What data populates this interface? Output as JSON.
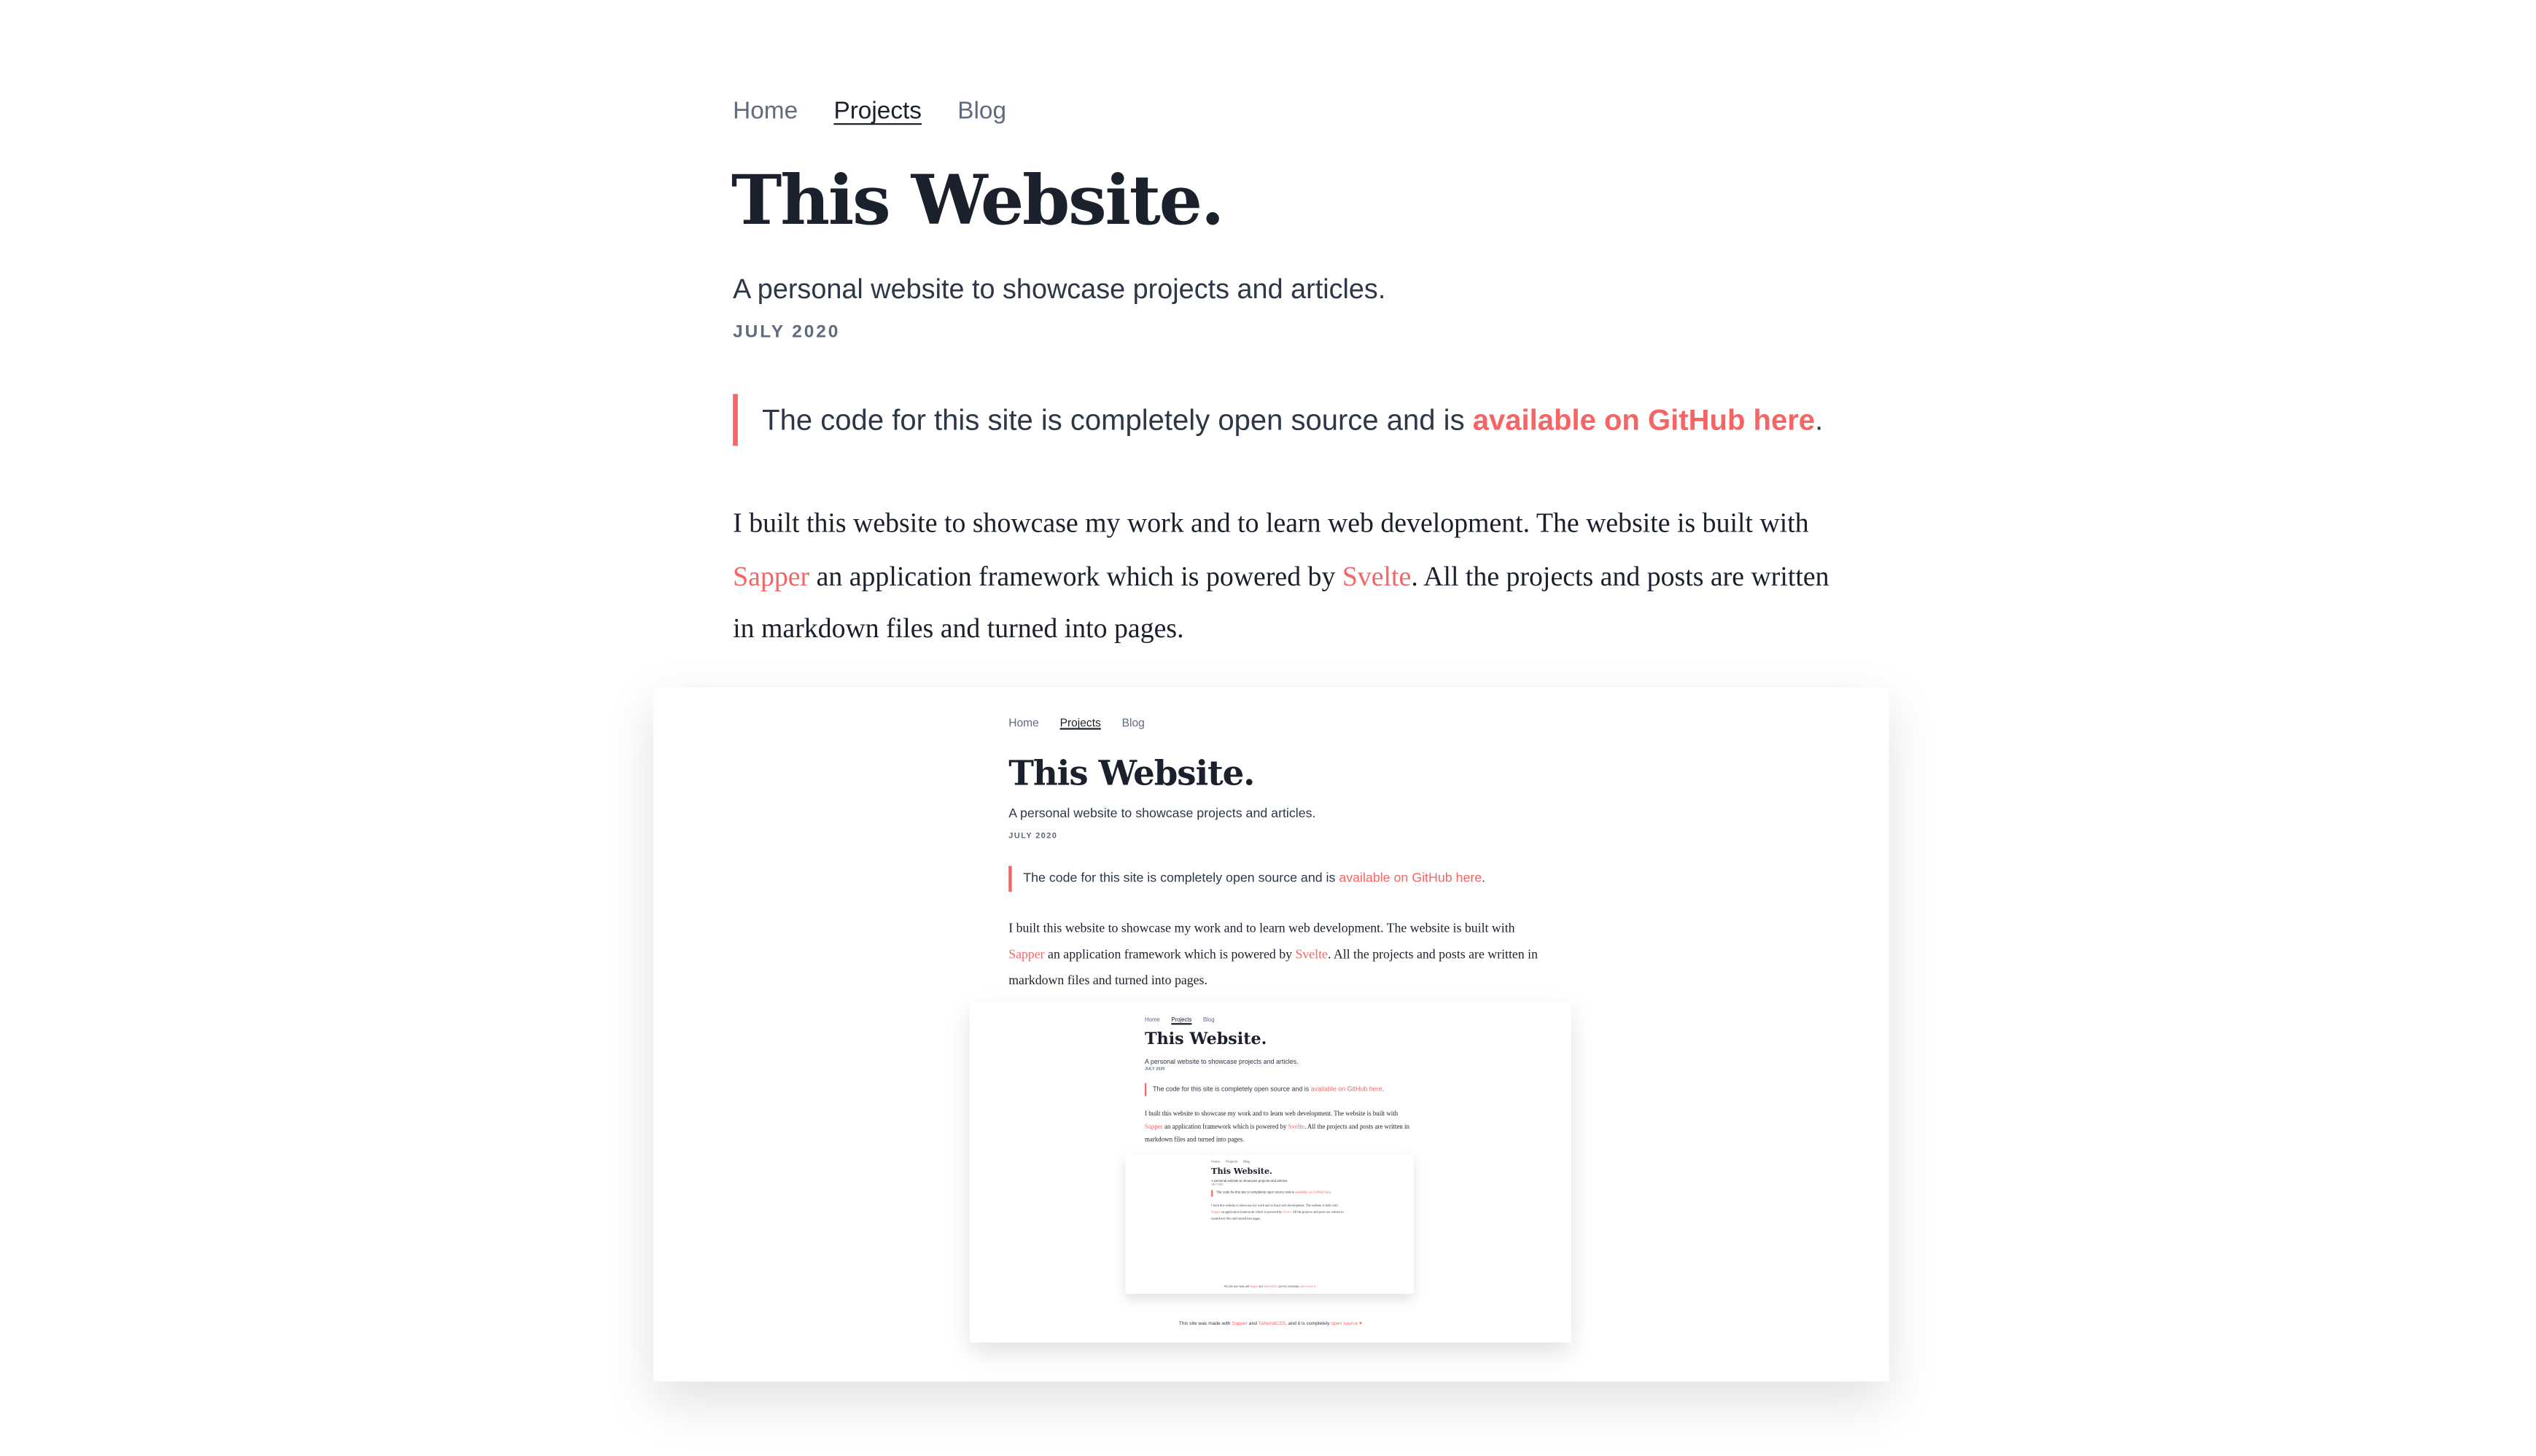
{
  "nav": {
    "home": "Home",
    "projects": "Projects",
    "blog": "Blog"
  },
  "post": {
    "title": "This Website.",
    "subtitle": "A personal website to showcase projects and articles.",
    "date": "JULY 2020"
  },
  "callout": {
    "text": "The code for this site is completely open source and is ",
    "link": "available on GitHub here",
    "end": "."
  },
  "body": {
    "p1": "I built this website to showcase my work and to learn web development. The website is built with ",
    "link1": "Sapper",
    "p2": " an application framework which is powered by ",
    "link2": "Svelte",
    "p3": ". All the projects and posts are written in markdown files and turned into pages."
  },
  "footer": {
    "t1": "This site was made with ",
    "l1": "Sapper",
    "t2": " and ",
    "l2": "TailwindCSS",
    "t3": ", and it is completely ",
    "l3": "open source",
    "heart": "♥"
  },
  "colors": {
    "accent": "#f56565",
    "heading": "#1a202c",
    "muted": "#5f6b7e"
  }
}
